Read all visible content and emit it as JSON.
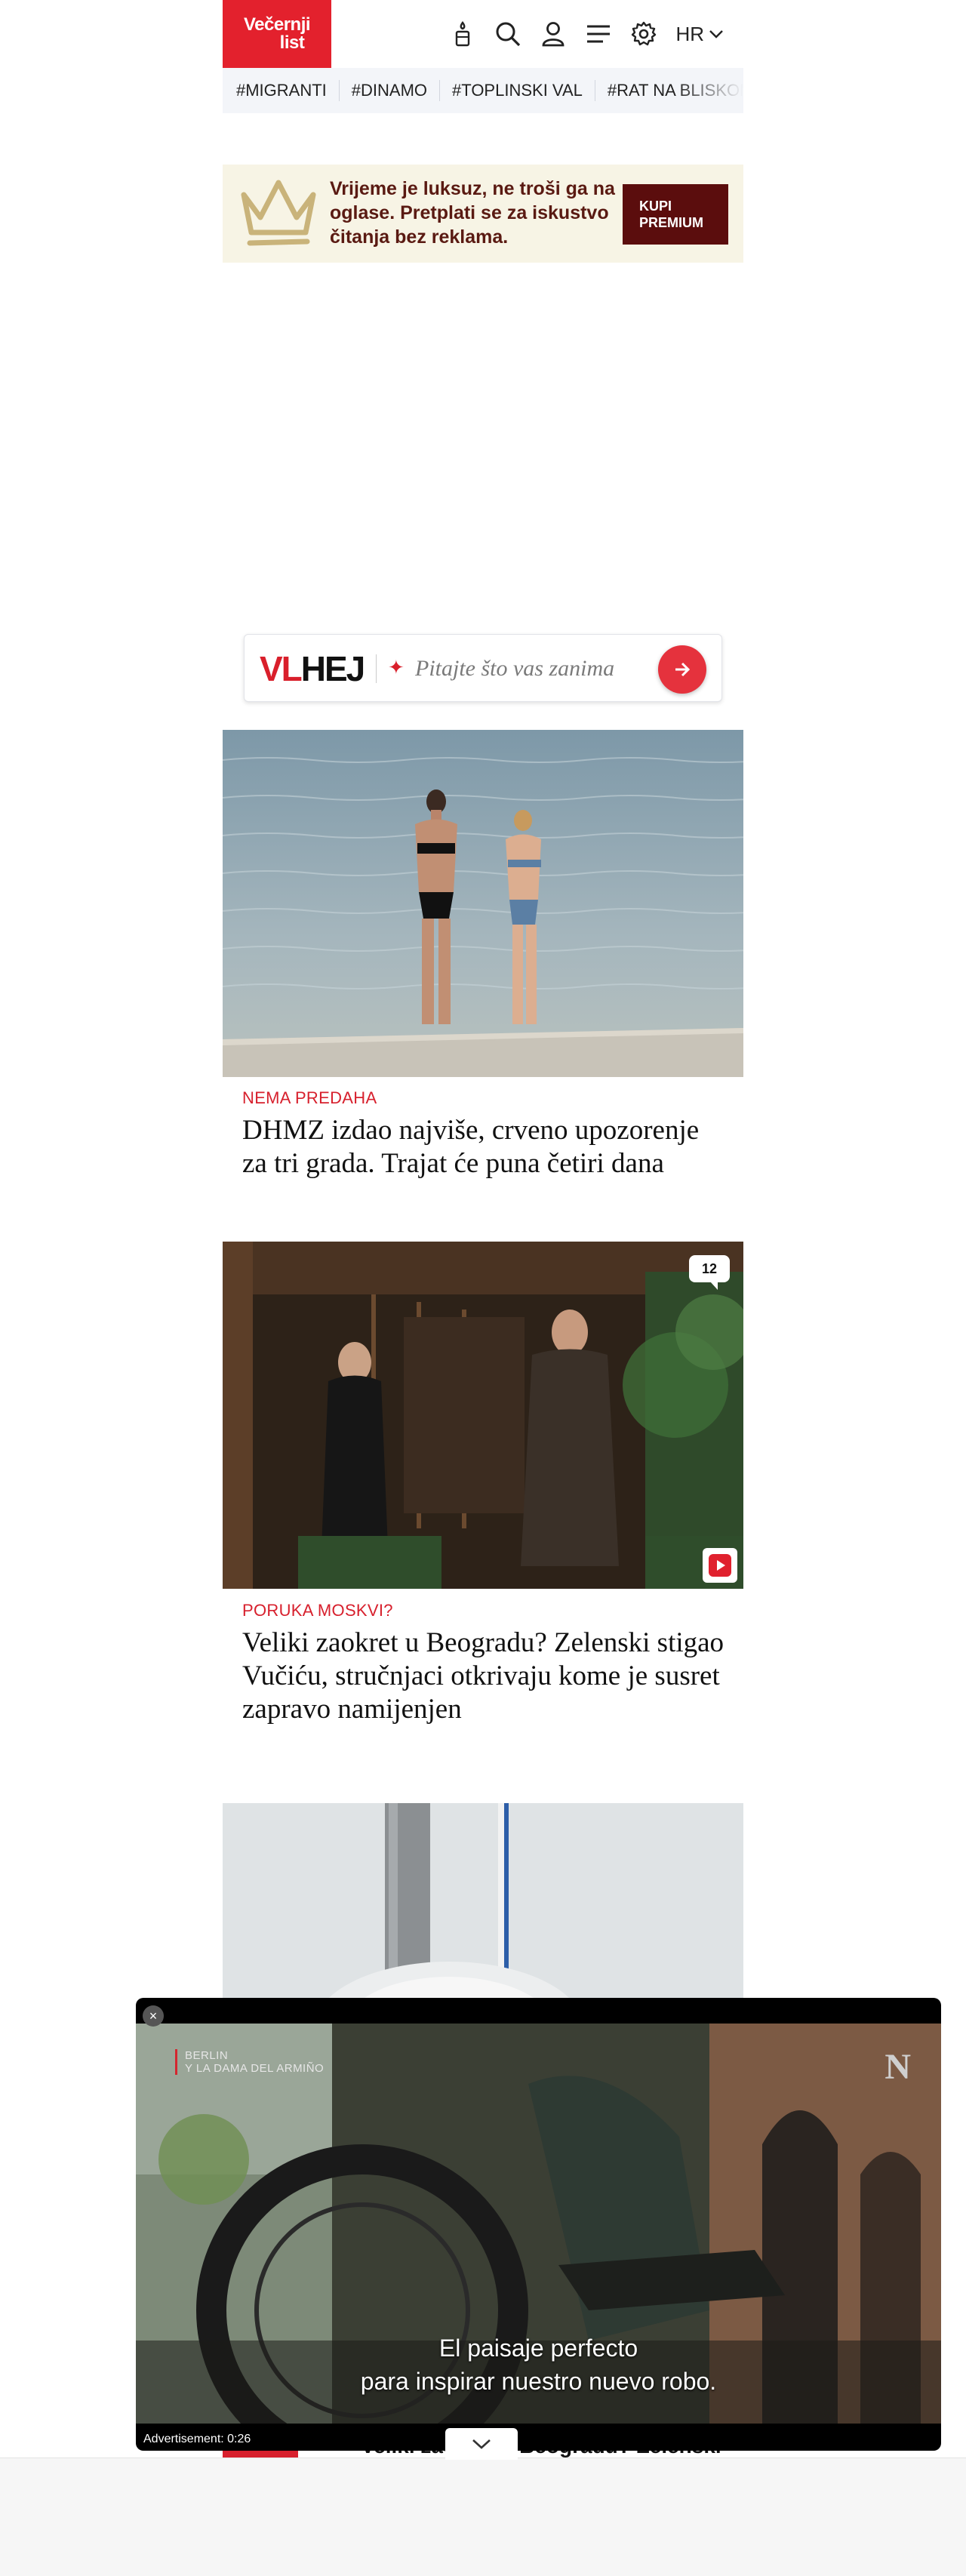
{
  "header": {
    "logo_line1": "Večernji",
    "logo_line2": "list",
    "language": "HR",
    "icons": [
      "candle-icon",
      "search-icon",
      "user-icon",
      "menu-icon",
      "settings-icon",
      "chevron-down-icon"
    ]
  },
  "tags": [
    "#MIGRANTI",
    "#DINAMO",
    "#TOPLINSKI VAL",
    "#RAT NA BLISKOM ISTOKU"
  ],
  "premium": {
    "text": "Vrijeme je luksuz, ne troši ga na oglase. Pretplati se za iskustvo čitanja bez reklama.",
    "button_line1": "KUPI",
    "button_line2": "PREMIUM"
  },
  "vlhej": {
    "logo_vl": "VL",
    "logo_hej": "HEJ",
    "placeholder": "Pitajte što vas zanima"
  },
  "articles": [
    {
      "kicker": "NEMA PREDAHA",
      "headline": "DHMZ izdao najviše, crveno upozorenje za tri grada. Trajat će puna četiri dana"
    },
    {
      "kicker": "PORUKA MOSKVI?",
      "headline": "Veliki zaokret u Beogradu? Zelenski stigao Vučiću, stručnjaci otkrivaju kome je susret zapravo namijenjen",
      "comments": "12"
    }
  ],
  "video_ad": {
    "title_line1": "BERLIN",
    "title_line2": "Y LA DAMA DEL ARMIÑO",
    "brand_mark": "N",
    "subtitle_line1": "El paisaje perfecto",
    "subtitle_line2": "para inspirar nuestro nuevo robo.",
    "ad_label": "Advertisement: 0:26",
    "close_label": "×"
  },
  "peek": {
    "text": "Veliki zaokret u Beogradu? Zelenski"
  },
  "colors": {
    "brand_red": "#e3212d",
    "premium_bg": "#f7f4e5",
    "premium_button": "#5b0d0d",
    "kicker_red": "#d7202d"
  }
}
